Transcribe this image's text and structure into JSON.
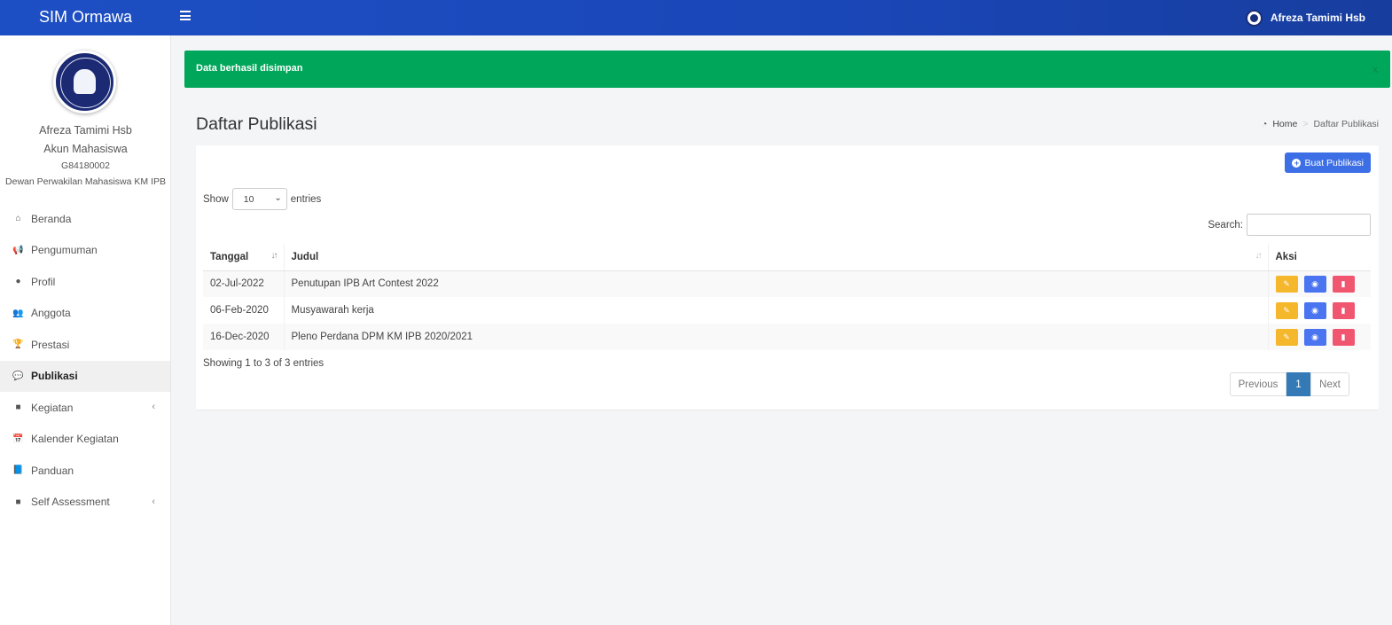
{
  "app": {
    "brand": "SIM Ormawa",
    "user": "Afreza Tamimi Hsb"
  },
  "profile": {
    "name": "Afreza Tamimi Hsb",
    "role": "Akun Mahasiswa",
    "nim": "G84180002",
    "org": "Dewan Perwakilan Mahasiswa KM IPB",
    "logo_text": [
      "INSTITUT PERTANIAN",
      "BOGOR"
    ]
  },
  "sidebar": {
    "items": [
      {
        "label": "Beranda",
        "icon": "home-icon",
        "glyph": "⌂"
      },
      {
        "label": "Pengumuman",
        "icon": "megaphone-icon",
        "glyph": "📢"
      },
      {
        "label": "Profil",
        "icon": "user-icon",
        "glyph": "●"
      },
      {
        "label": "Anggota",
        "icon": "users-icon",
        "glyph": "👥"
      },
      {
        "label": "Prestasi",
        "icon": "trophy-icon",
        "glyph": "🏆"
      },
      {
        "label": "Publikasi",
        "icon": "comments-icon",
        "glyph": "💬"
      },
      {
        "label": "Kegiatan",
        "icon": "folder-icon",
        "glyph": "■"
      },
      {
        "label": "Kalender Kegiatan",
        "icon": "calendar-icon",
        "glyph": "📅"
      },
      {
        "label": "Panduan",
        "icon": "book-icon",
        "glyph": "📘"
      },
      {
        "label": "Self Assessment",
        "icon": "folder-icon",
        "glyph": "■"
      }
    ],
    "active": "Publikasi"
  },
  "alert": {
    "message": "Data berhasil disimpan",
    "close": "x"
  },
  "page": {
    "title": "Daftar Publikasi",
    "breadcrumb": {
      "home": "Home",
      "sep": ">",
      "current": "Daftar Publikasi"
    }
  },
  "toolbar": {
    "create_label": "Buat Publikasi"
  },
  "table_controls": {
    "show": "Show",
    "entries": "entries",
    "page_size": "10",
    "search_label": "Search:"
  },
  "table": {
    "columns": [
      "Tanggal",
      "Judul",
      "Aksi"
    ],
    "rows": [
      {
        "tanggal": "02-Jul-2022",
        "judul": "Penutupan IPB Art Contest 2022"
      },
      {
        "tanggal": "06-Feb-2020",
        "judul": "Musyawarah kerja"
      },
      {
        "tanggal": "16-Dec-2020",
        "judul": "Pleno Perdana DPM KM IPB 2020/2021"
      }
    ]
  },
  "footer": {
    "info": "Showing 1 to 3 of 3 entries",
    "prev": "Previous",
    "page": "1",
    "next": "Next"
  },
  "colors": {
    "topbar": "#1d4fc4",
    "success": "#00a65a",
    "primary": "#3c6ee6",
    "edit": "#f5b72b",
    "view": "#4a74f0",
    "delete": "#f0566f",
    "pager_active": "#337ab7"
  }
}
